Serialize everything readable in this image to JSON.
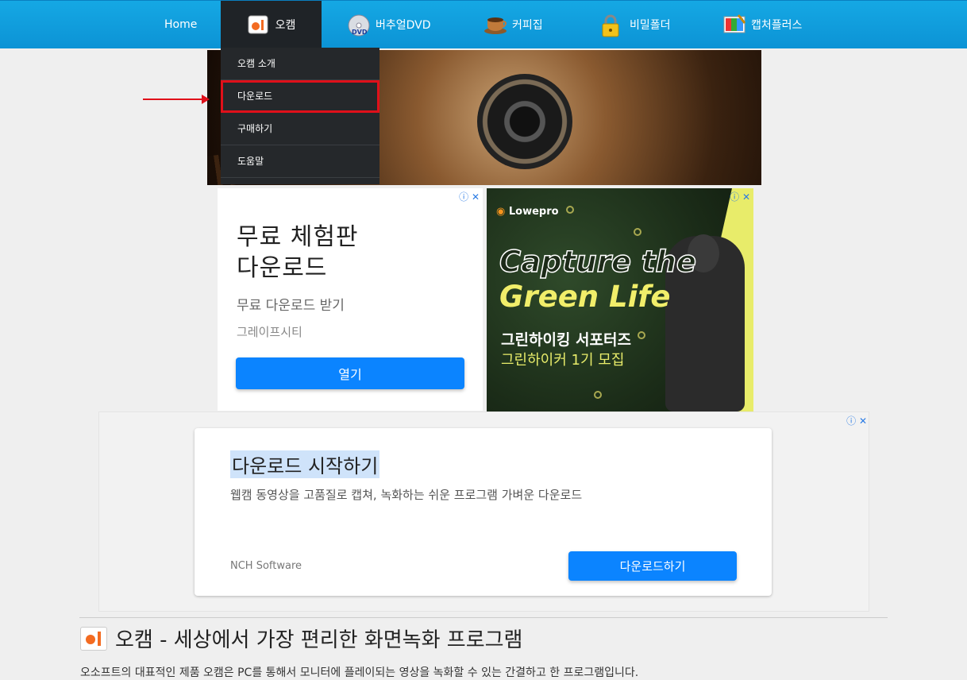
{
  "nav": {
    "items": [
      {
        "label": "Home",
        "icon": ""
      },
      {
        "label": "오캠",
        "icon": "ocam-icon"
      },
      {
        "label": "버추얼DVD",
        "icon": "dvd-icon"
      },
      {
        "label": "커피집",
        "icon": "coffee-icon"
      },
      {
        "label": "비밀폴더",
        "icon": "lock-icon"
      },
      {
        "label": "캡처플러스",
        "icon": "palette-icon"
      }
    ]
  },
  "dropdown": {
    "items": [
      "오캠 소개",
      "다운로드",
      "구매하기",
      "도움말"
    ]
  },
  "ad1": {
    "title_line1": "무료 체험판",
    "title_line2": "다운로드",
    "subtitle": "무료 다운로드 받기",
    "brand": "그레이프시티",
    "button": "열기"
  },
  "ad2": {
    "logo": "Lowepro",
    "headline1": "Capture the",
    "headline2": "Green Life",
    "text1": "그린하이킹 서포터즈",
    "text2": "그린하이커 1기 모집"
  },
  "ad3": {
    "title": "다운로드 시작하기",
    "description": "웹캠 동영상을 고품질로 캡쳐, 녹화하는 쉬운 프로그램 가벼운 다운로드",
    "brand": "NCH Software",
    "button": "다운로드하기"
  },
  "page": {
    "title": "오캠 - 세상에서 가장 편리한 화면녹화 프로그램",
    "body": "오소프트의 대표적인 제품 오캠은 PC를 통해서 모니터에 플레이되는 영상을 녹화할 수 있는 간결하고 한 프로그램입니다."
  },
  "colors": {
    "nav_bg": "#0c93d5",
    "accent": "#0b84ff",
    "highlight": "#e0101a"
  }
}
